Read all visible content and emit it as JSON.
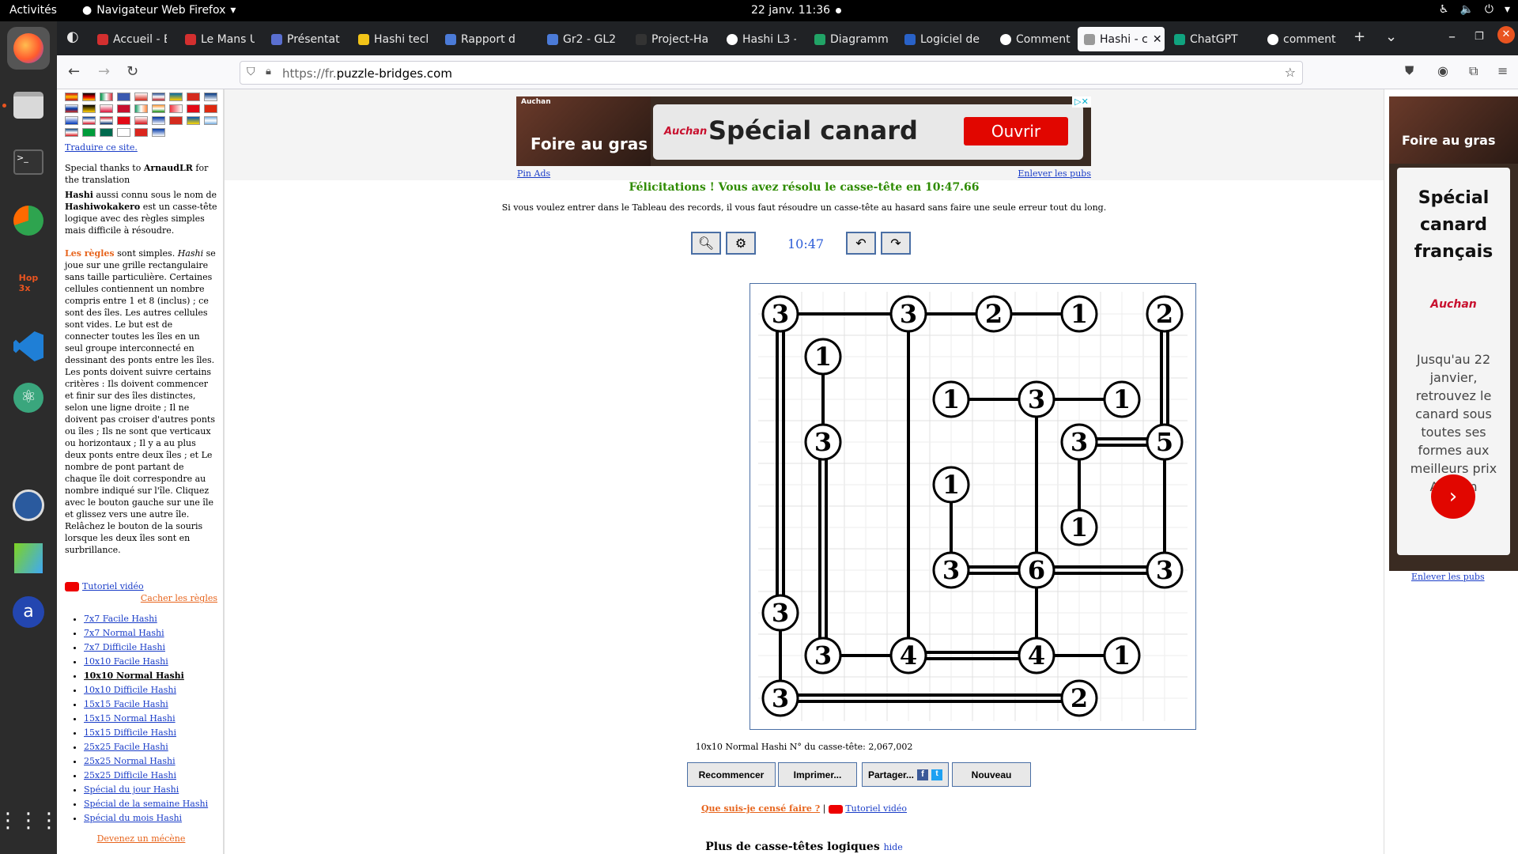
{
  "system_bar": {
    "activities": "Activités",
    "app_name": "Navigateur Web Firefox",
    "clock": "22 janv.  11:36"
  },
  "tabs": [
    {
      "label": "Accueil - E",
      "color": "#d32f2f"
    },
    {
      "label": "Le Mans U",
      "color": "#d32f2f"
    },
    {
      "label": "Présentat",
      "color": "#5a6fd0"
    },
    {
      "label": "Hashi tech",
      "color": "#f2c418"
    },
    {
      "label": "Rapport d",
      "color": "#4b7bd8"
    },
    {
      "label": "Gr2 - GL2",
      "color": "#4b7bd8"
    },
    {
      "label": "Project-Ha",
      "color": "#333333"
    },
    {
      "label": "Hashi L3 -",
      "color": "#ffffff"
    },
    {
      "label": "Diagramm",
      "color": "#21a366"
    },
    {
      "label": "Logiciel de",
      "color": "#2962c8"
    },
    {
      "label": "Comment",
      "color": "#ffffff"
    },
    {
      "label": "Hashi - c",
      "color": "#999999"
    },
    {
      "label": "ChatGPT",
      "color": "#10a37f"
    },
    {
      "label": "comment",
      "color": "#ffffff"
    }
  ],
  "url": {
    "prefix": "https://fr.",
    "domain": "puzzle-bridges.com"
  },
  "sidebar": {
    "translate": "Traduire ce site.",
    "thanks_pre": "Special thanks to ",
    "thanks_name": "ArnaudLR",
    "thanks_post": " for the translation",
    "intro_b1": "Hashi",
    "intro_t1": " aussi connu sous le nom de ",
    "intro_b2": "Hashiwokakero",
    "intro_t2": " est un casse-tête logique avec des règles simples mais difficile à résoudre.",
    "rules_title": "Les règles",
    "rules_t1": " sont simples. ",
    "rules_i": "Hashi",
    "rules_t2": " se joue sur une grille rectangulaire sans taille particulière. Certaines cellules contiennent un nombre compris entre 1 et 8 (inclus) ; ce sont des îles. Les autres cellules sont vides. Le but est de connecter toutes les îles en un seul groupe interconnecté en dessinant des ponts entre les îles. Les ponts doivent suivre certains critères : Ils doivent commencer et finir sur des îles distinctes, selon une ligne droite ; Il ne doivent pas croiser d'autres ponts ou îles ; Ils ne sont que verticaux ou horizontaux ; Il y a au plus deux ponts entre deux îles ; et Le nombre de pont partant de chaque île doit correspondre au nombre indiqué sur l'île. Cliquez avec le bouton gauche sur une île et glissez vers une autre île. Relâchez le bouton de la souris lorsque les deux îles sont en surbrillance.",
    "video": "Tutoriel vidéo",
    "hide_rules": "Cacher les règles",
    "links": [
      "7x7 Facile Hashi",
      "7x7 Normal Hashi",
      "7x7 Difficile Hashi",
      "10x10 Facile Hashi",
      "10x10 Normal Hashi",
      "10x10 Difficile Hashi",
      "15x15 Facile Hashi",
      "15x15 Normal Hashi",
      "15x15 Difficile Hashi",
      "25x25 Facile Hashi",
      "25x25 Normal Hashi",
      "25x25 Difficile Hashi",
      "Spécial du jour Hashi",
      "Spécial de la semaine Hashi",
      "Spécial du mois Hashi"
    ],
    "active_link": 4,
    "patron": "Devenez un mécène"
  },
  "ad_top": {
    "brand": "Auchan",
    "title": "Spécial canard",
    "cta": "Ouvrir",
    "image_text": "Foire au gras",
    "pin": "Pin Ads",
    "remove": "Enlever les pubs"
  },
  "ad_right": {
    "image_text": "Foire au gras",
    "title": "Spécial canard français",
    "brand": "Auchan",
    "text": "Jusqu'au 22 janvier, retrouvez le canard sous toutes ses formes aux meilleurs prix Auchan",
    "remove": "Enlever les pubs"
  },
  "game": {
    "congrats": "Félicitations ! Vous avez résolu le casse-tête en 10:47.66",
    "info": "Si vous voulez entrer dans le Tableau des records, il vous faut résoudre un casse-tête au hasard sans faire une seule erreur tout du long.",
    "timer": "10:47",
    "caption": "10x10 Normal Hashi N° du casse-tête: 2,067,002",
    "buttons": {
      "restart": "Recommencer",
      "print": "Imprimer...",
      "share": "Partager...",
      "new": "Nouveau"
    },
    "what_to_do": "Que suis-je censé faire ?",
    "separator": " | ",
    "tutorial": "Tutoriel vidéo",
    "more": "Plus de casse-têtes logiques",
    "hide": "hide"
  },
  "chart_data": {
    "type": "table",
    "grid_size": [
      10,
      10
    ],
    "islands": [
      {
        "col": 0,
        "row": 0,
        "value": 3
      },
      {
        "col": 3,
        "row": 0,
        "value": 3
      },
      {
        "col": 5,
        "row": 0,
        "value": 2
      },
      {
        "col": 7,
        "row": 0,
        "value": 1
      },
      {
        "col": 9,
        "row": 0,
        "value": 2
      },
      {
        "col": 1,
        "row": 1,
        "value": 1
      },
      {
        "col": 4,
        "row": 2,
        "value": 1
      },
      {
        "col": 6,
        "row": 2,
        "value": 3
      },
      {
        "col": 8,
        "row": 2,
        "value": 1
      },
      {
        "col": 1,
        "row": 3,
        "value": 3
      },
      {
        "col": 7,
        "row": 3,
        "value": 3
      },
      {
        "col": 9,
        "row": 3,
        "value": 5
      },
      {
        "col": 4,
        "row": 4,
        "value": 1
      },
      {
        "col": 7,
        "row": 5,
        "value": 1
      },
      {
        "col": 4,
        "row": 6,
        "value": 3
      },
      {
        "col": 6,
        "row": 6,
        "value": 6
      },
      {
        "col": 9,
        "row": 6,
        "value": 3
      },
      {
        "col": 0,
        "row": 7,
        "value": 3
      },
      {
        "col": 1,
        "row": 8,
        "value": 3
      },
      {
        "col": 3,
        "row": 8,
        "value": 4
      },
      {
        "col": 6,
        "row": 8,
        "value": 4
      },
      {
        "col": 8,
        "row": 8,
        "value": 1
      },
      {
        "col": 0,
        "row": 9,
        "value": 3
      },
      {
        "col": 7,
        "row": 9,
        "value": 2
      }
    ],
    "bridges": [
      {
        "a": [
          0,
          0
        ],
        "b": [
          3,
          0
        ],
        "n": 1
      },
      {
        "a": [
          3,
          0
        ],
        "b": [
          5,
          0
        ],
        "n": 1
      },
      {
        "a": [
          5,
          0
        ],
        "b": [
          7,
          0
        ],
        "n": 1
      },
      {
        "a": [
          0,
          0
        ],
        "b": [
          0,
          7
        ],
        "n": 2
      },
      {
        "a": [
          0,
          7
        ],
        "b": [
          0,
          9
        ],
        "n": 1
      },
      {
        "a": [
          0,
          9
        ],
        "b": [
          7,
          9
        ],
        "n": 2
      },
      {
        "a": [
          3,
          0
        ],
        "b": [
          3,
          8
        ],
        "n": 1
      },
      {
        "a": [
          9,
          0
        ],
        "b": [
          9,
          3
        ],
        "n": 2
      },
      {
        "a": [
          9,
          3
        ],
        "b": [
          9,
          6
        ],
        "n": 1
      },
      {
        "a": [
          7,
          3
        ],
        "b": [
          9,
          3
        ],
        "n": 2
      },
      {
        "a": [
          1,
          1
        ],
        "b": [
          1,
          3
        ],
        "n": 1
      },
      {
        "a": [
          1,
          3
        ],
        "b": [
          1,
          8
        ],
        "n": 2
      },
      {
        "a": [
          1,
          8
        ],
        "b": [
          3,
          8
        ],
        "n": 1
      },
      {
        "a": [
          3,
          8
        ],
        "b": [
          6,
          8
        ],
        "n": 2
      },
      {
        "a": [
          6,
          8
        ],
        "b": [
          8,
          8
        ],
        "n": 1
      },
      {
        "a": [
          4,
          2
        ],
        "b": [
          6,
          2
        ],
        "n": 1
      },
      {
        "a": [
          6,
          2
        ],
        "b": [
          8,
          2
        ],
        "n": 1
      },
      {
        "a": [
          6,
          2
        ],
        "b": [
          6,
          6
        ],
        "n": 1
      },
      {
        "a": [
          7,
          3
        ],
        "b": [
          7,
          5
        ],
        "n": 1
      },
      {
        "a": [
          4,
          4
        ],
        "b": [
          4,
          6
        ],
        "n": 1
      },
      {
        "a": [
          4,
          6
        ],
        "b": [
          6,
          6
        ],
        "n": 2
      },
      {
        "a": [
          6,
          6
        ],
        "b": [
          9,
          6
        ],
        "n": 2
      },
      {
        "a": [
          6,
          6
        ],
        "b": [
          6,
          8
        ],
        "n": 1
      }
    ]
  },
  "colors": {
    "accent": "#2e5ed8",
    "success": "#2e8b00",
    "link": "#1a3dc8",
    "orange": "#e7641c",
    "ad_red": "#e10600"
  }
}
